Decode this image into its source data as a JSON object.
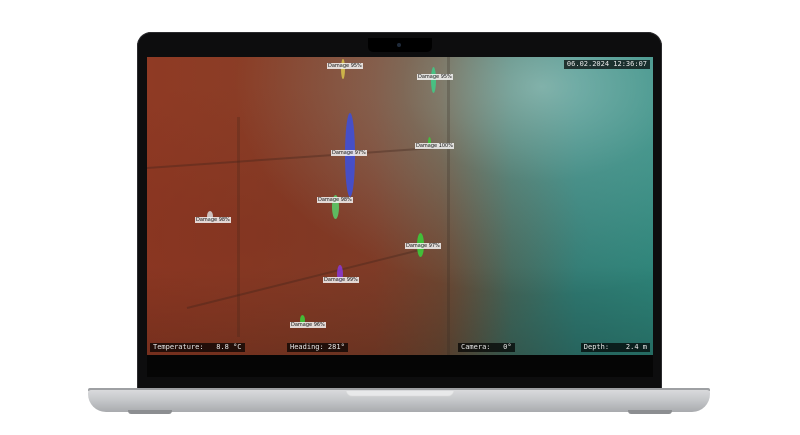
{
  "overlay": {
    "timestamp": "06.02.2024 12:36:07",
    "temperature": "Temperature:   8.8 °C",
    "heading": "Heading: 281°",
    "camera": "Camera:   0°",
    "depth": "Depth:    2.4 m"
  },
  "detections": [
    {
      "label": "Damage 95%",
      "color": "#c9b44a"
    },
    {
      "label": "Damage 95%",
      "color": "#3ad28a"
    },
    {
      "label": "Damage 97%",
      "color": "#3a3ad8"
    },
    {
      "label": "Damage 98%",
      "color": "#3ad28a"
    },
    {
      "label": "Damage 97%",
      "color": "#3ad28a"
    },
    {
      "label": "Damage 98%",
      "color": "#bfbfbf"
    },
    {
      "label": "Damage 100%",
      "color": "#3ad28a"
    },
    {
      "label": "Damage 99%",
      "color": "#8a3ad8"
    },
    {
      "label": "Damage 96%",
      "color": "#3ad28a"
    }
  ]
}
